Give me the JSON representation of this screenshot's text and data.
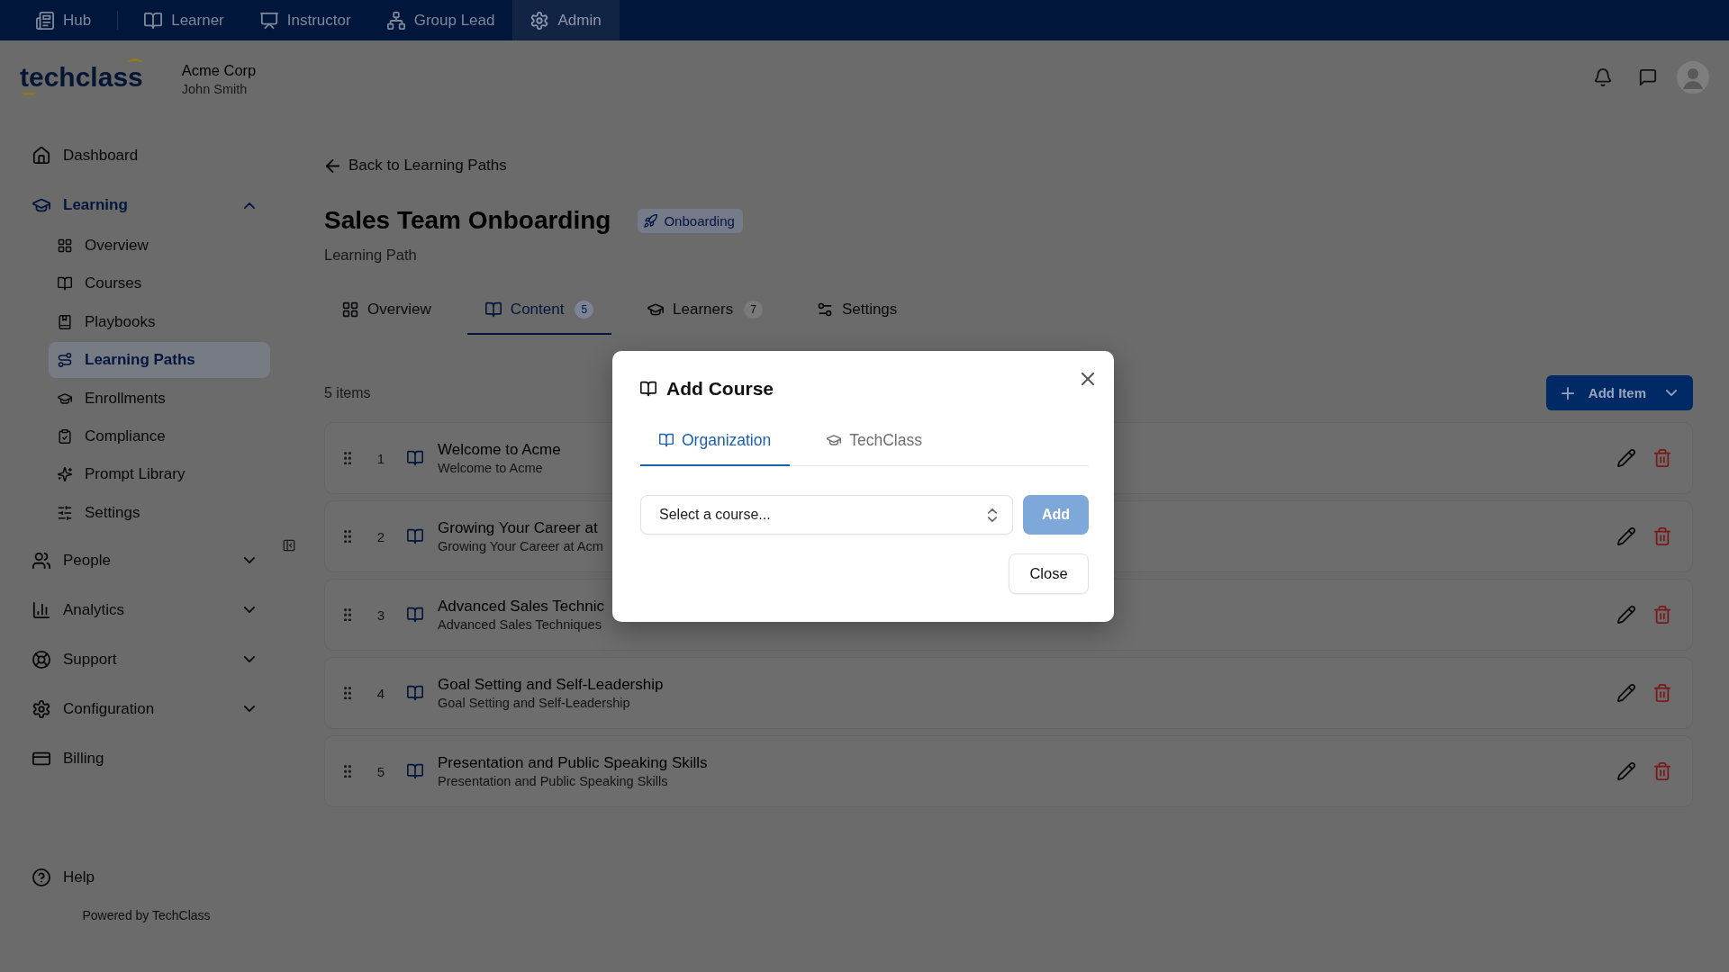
{
  "top_nav": {
    "tabs": [
      {
        "label": "Hub",
        "selected": false
      },
      {
        "label": "Learner",
        "selected": false
      },
      {
        "label": "Instructor",
        "selected": false
      },
      {
        "label": "Group Lead",
        "selected": false
      },
      {
        "label": "Admin",
        "selected": true
      }
    ]
  },
  "header": {
    "logo": "techclass",
    "organization": "Acme Corp",
    "user_name": "John Smith"
  },
  "sidebar": {
    "items": [
      {
        "label": "Dashboard",
        "kind": "link",
        "selected": false
      },
      {
        "label": "Learning",
        "kind": "group",
        "selected": true,
        "expanded": true,
        "children": [
          {
            "label": "Overview",
            "selected": false
          },
          {
            "label": "Courses",
            "selected": false
          },
          {
            "label": "Playbooks",
            "selected": false
          },
          {
            "label": "Learning Paths",
            "selected": true
          },
          {
            "label": "Enrollments",
            "selected": false
          },
          {
            "label": "Compliance",
            "selected": false
          },
          {
            "label": "Prompt Library",
            "selected": false
          },
          {
            "label": "Settings",
            "selected": false
          }
        ]
      },
      {
        "label": "People",
        "kind": "group",
        "selected": false,
        "expanded": false
      },
      {
        "label": "Analytics",
        "kind": "group",
        "selected": false,
        "expanded": false
      },
      {
        "label": "Support",
        "kind": "group",
        "selected": false,
        "expanded": false
      },
      {
        "label": "Configuration",
        "kind": "group",
        "selected": false,
        "expanded": false
      },
      {
        "label": "Billing",
        "kind": "link",
        "selected": false
      }
    ],
    "help": "Help",
    "powered_by": "Powered by TechClass"
  },
  "page": {
    "back_link": "Back to Learning Paths",
    "title": "Sales Team Onboarding",
    "badge": "Onboarding",
    "subtitle": "Learning Path",
    "tabs": [
      {
        "label": "Overview",
        "selected": false
      },
      {
        "label": "Content",
        "count": "5",
        "selected": true
      },
      {
        "label": "Learners",
        "count": "7",
        "selected": false
      },
      {
        "label": "Settings",
        "selected": false
      }
    ],
    "item_count": "5 items",
    "add_button": "Add Item",
    "items": [
      {
        "number": "1",
        "title": "Welcome to Acme",
        "subtitle": "Welcome to Acme"
      },
      {
        "number": "2",
        "title": "Growing Your Career at",
        "subtitle": "Growing Your Career at Acm"
      },
      {
        "number": "3",
        "title": "Advanced Sales Technic",
        "subtitle": "Advanced Sales Techniques"
      },
      {
        "number": "4",
        "title": "Goal Setting and Self-Leadership",
        "subtitle": "Goal Setting and Self-Leadership"
      },
      {
        "number": "5",
        "title": "Presentation and Public Speaking Skills",
        "subtitle": "Presentation and Public Speaking Skills"
      }
    ]
  },
  "dialog": {
    "title": "Add Course",
    "tabs": [
      {
        "label": "Organization",
        "selected": true
      },
      {
        "label": "TechClass",
        "selected": false
      }
    ],
    "course_select": {
      "placeholder": "Select a course..."
    },
    "add_button": {
      "label": "Add",
      "disabled": true
    },
    "close_button": "Close"
  }
}
